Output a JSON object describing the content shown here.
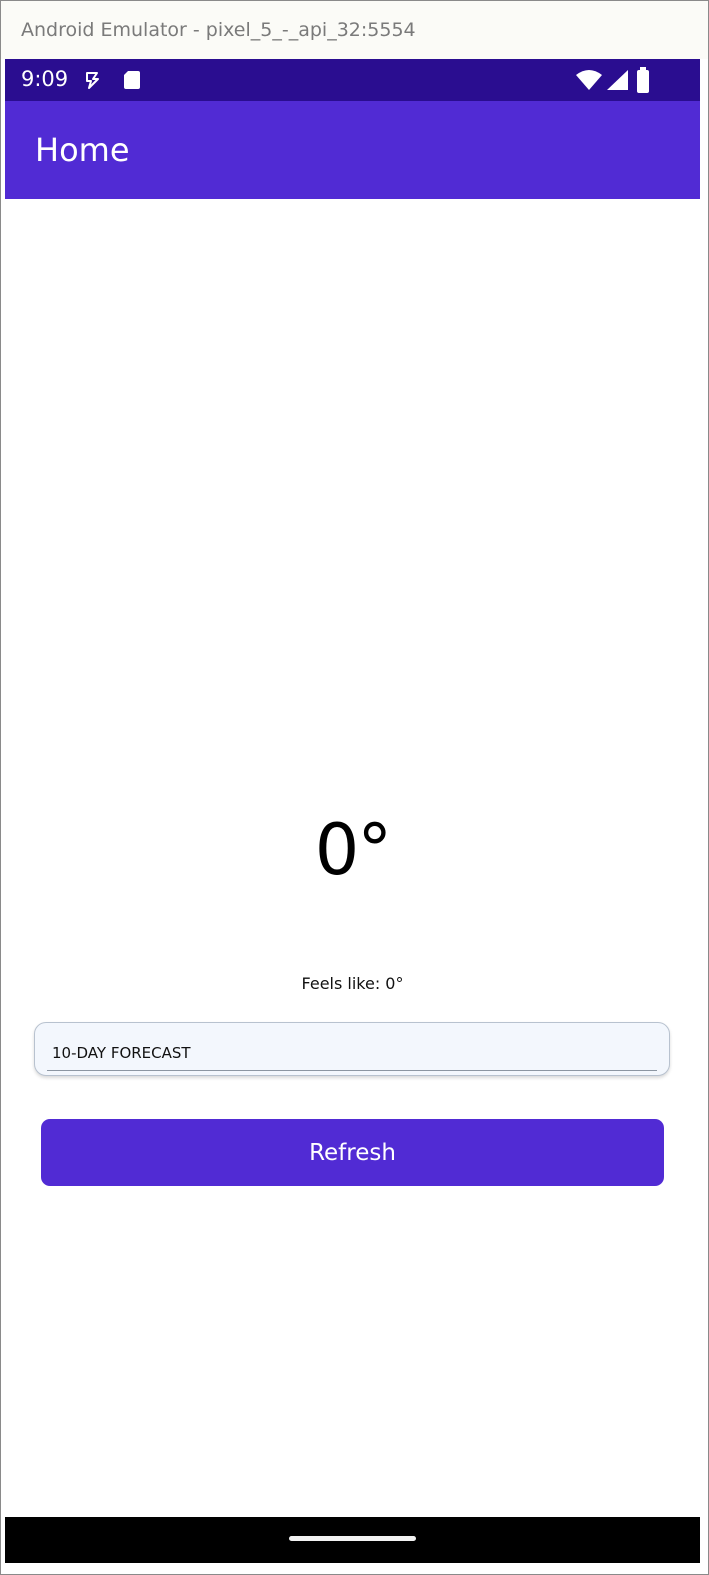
{
  "window": {
    "title": "Android Emulator - pixel_5_-_api_32:5554"
  },
  "status_bar": {
    "time": "9:09",
    "icons": [
      "data-saver-icon",
      "sd-card-icon",
      "wifi-icon",
      "cell-signal-icon",
      "battery-icon"
    ]
  },
  "app_bar": {
    "title": "Home"
  },
  "weather": {
    "temperature": "0°",
    "feels_like": "Feels like: 0°"
  },
  "forecast": {
    "label": "10-DAY FORECAST"
  },
  "actions": {
    "refresh_label": "Refresh"
  },
  "colors": {
    "status_bar": "#2a0d90",
    "primary": "#512bd4",
    "nav_bar": "#000000"
  }
}
